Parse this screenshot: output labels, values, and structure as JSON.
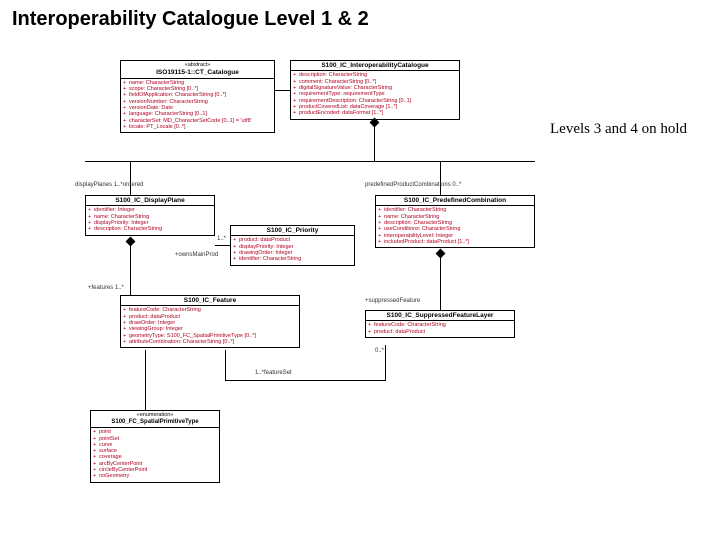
{
  "title": "Interoperability Catalogue Level 1 & 2",
  "side_note": "Levels 3 and 4 on hold",
  "labels": {
    "displayPlanes": "displayPlanes  1..*ordered",
    "predefined": "predefinedProductCombinations  0..*",
    "ownsMain": "+ownsMainProd",
    "features": "+features 1..*",
    "suppressed": "+suppressedFeature",
    "featureSet": "1..*featureSet",
    "zeroStar": "0..*",
    "oneStar": "1..*"
  },
  "classes": {
    "catalogue": {
      "stereo": "«abstract»",
      "name": "ISO19115-1::CT_Catalogue",
      "attrs": [
        "name: CharacterString",
        "scope: CharacterString [0..*]",
        "fieldOfApplication: CharacterString [0..*]",
        "versionNumber: CharacterString",
        "versionDate: Date",
        "language: CharacterString [0..1]",
        "characterSet: MD_CharacterSetCode [0..1] = 'utf8'",
        "locale: PT_Locale [0..*]"
      ]
    },
    "ic": {
      "name": "S100_IC_InteroperabilityCatalogue",
      "attrs": [
        "description: CharacterString",
        "comment: CharacterString [0..*]",
        "digitalSignatureValue: CharacterString",
        "requirementType: requirementType",
        "requirementDescription: CharacterString [0..1]",
        "productCoveredList: dataCoverage [1..*]",
        "productEncoded: dataFormat [1..*]"
      ]
    },
    "displayPlane": {
      "name": "S100_IC_DisplayPlane",
      "attrs": [
        "identifier: Integer",
        "name: CharacterString",
        "displayPriority: Integer",
        "description: CharacterString"
      ]
    },
    "priority": {
      "name": "S100_IC_Priority",
      "attrs": [
        "product: dataProduct",
        "displayPriority: Integer",
        "drawingOrder: Integer",
        "identifier: CharacterString"
      ]
    },
    "predef": {
      "name": "S100_IC_PredefinedCombination",
      "attrs": [
        "identifier: CharacterString",
        "name: CharacterString",
        "description: CharacterString",
        "useConditions: CharacterString",
        "interoperabilityLevel: Integer",
        "includedProduct: dataProduct [1..*]"
      ]
    },
    "featureClass": {
      "name": "S100_IC_Feature",
      "attrs": [
        "featureCode: CharacterString",
        "product: dataProduct",
        "drawOrder: Integer",
        "viewingGroup: Integer",
        "geometryType: S100_FC_SpatialPrimitiveType [0..*]",
        "attributeCombination: CharacterString [0..*]"
      ]
    },
    "suppressed": {
      "name": "S100_IC_SuppressedFeatureLayer",
      "attrs": [
        "featureCode: CharacterString",
        "product: dataProduct"
      ]
    },
    "enum": {
      "stereo": "«enumeration»",
      "name": "S100_FC_SpatialPrimitiveType",
      "values": [
        "point",
        "pointSet",
        "curve",
        "surface",
        "coverage",
        "arcByCenterPoint",
        "circleByCenterPoint",
        "noGeometry"
      ]
    }
  }
}
